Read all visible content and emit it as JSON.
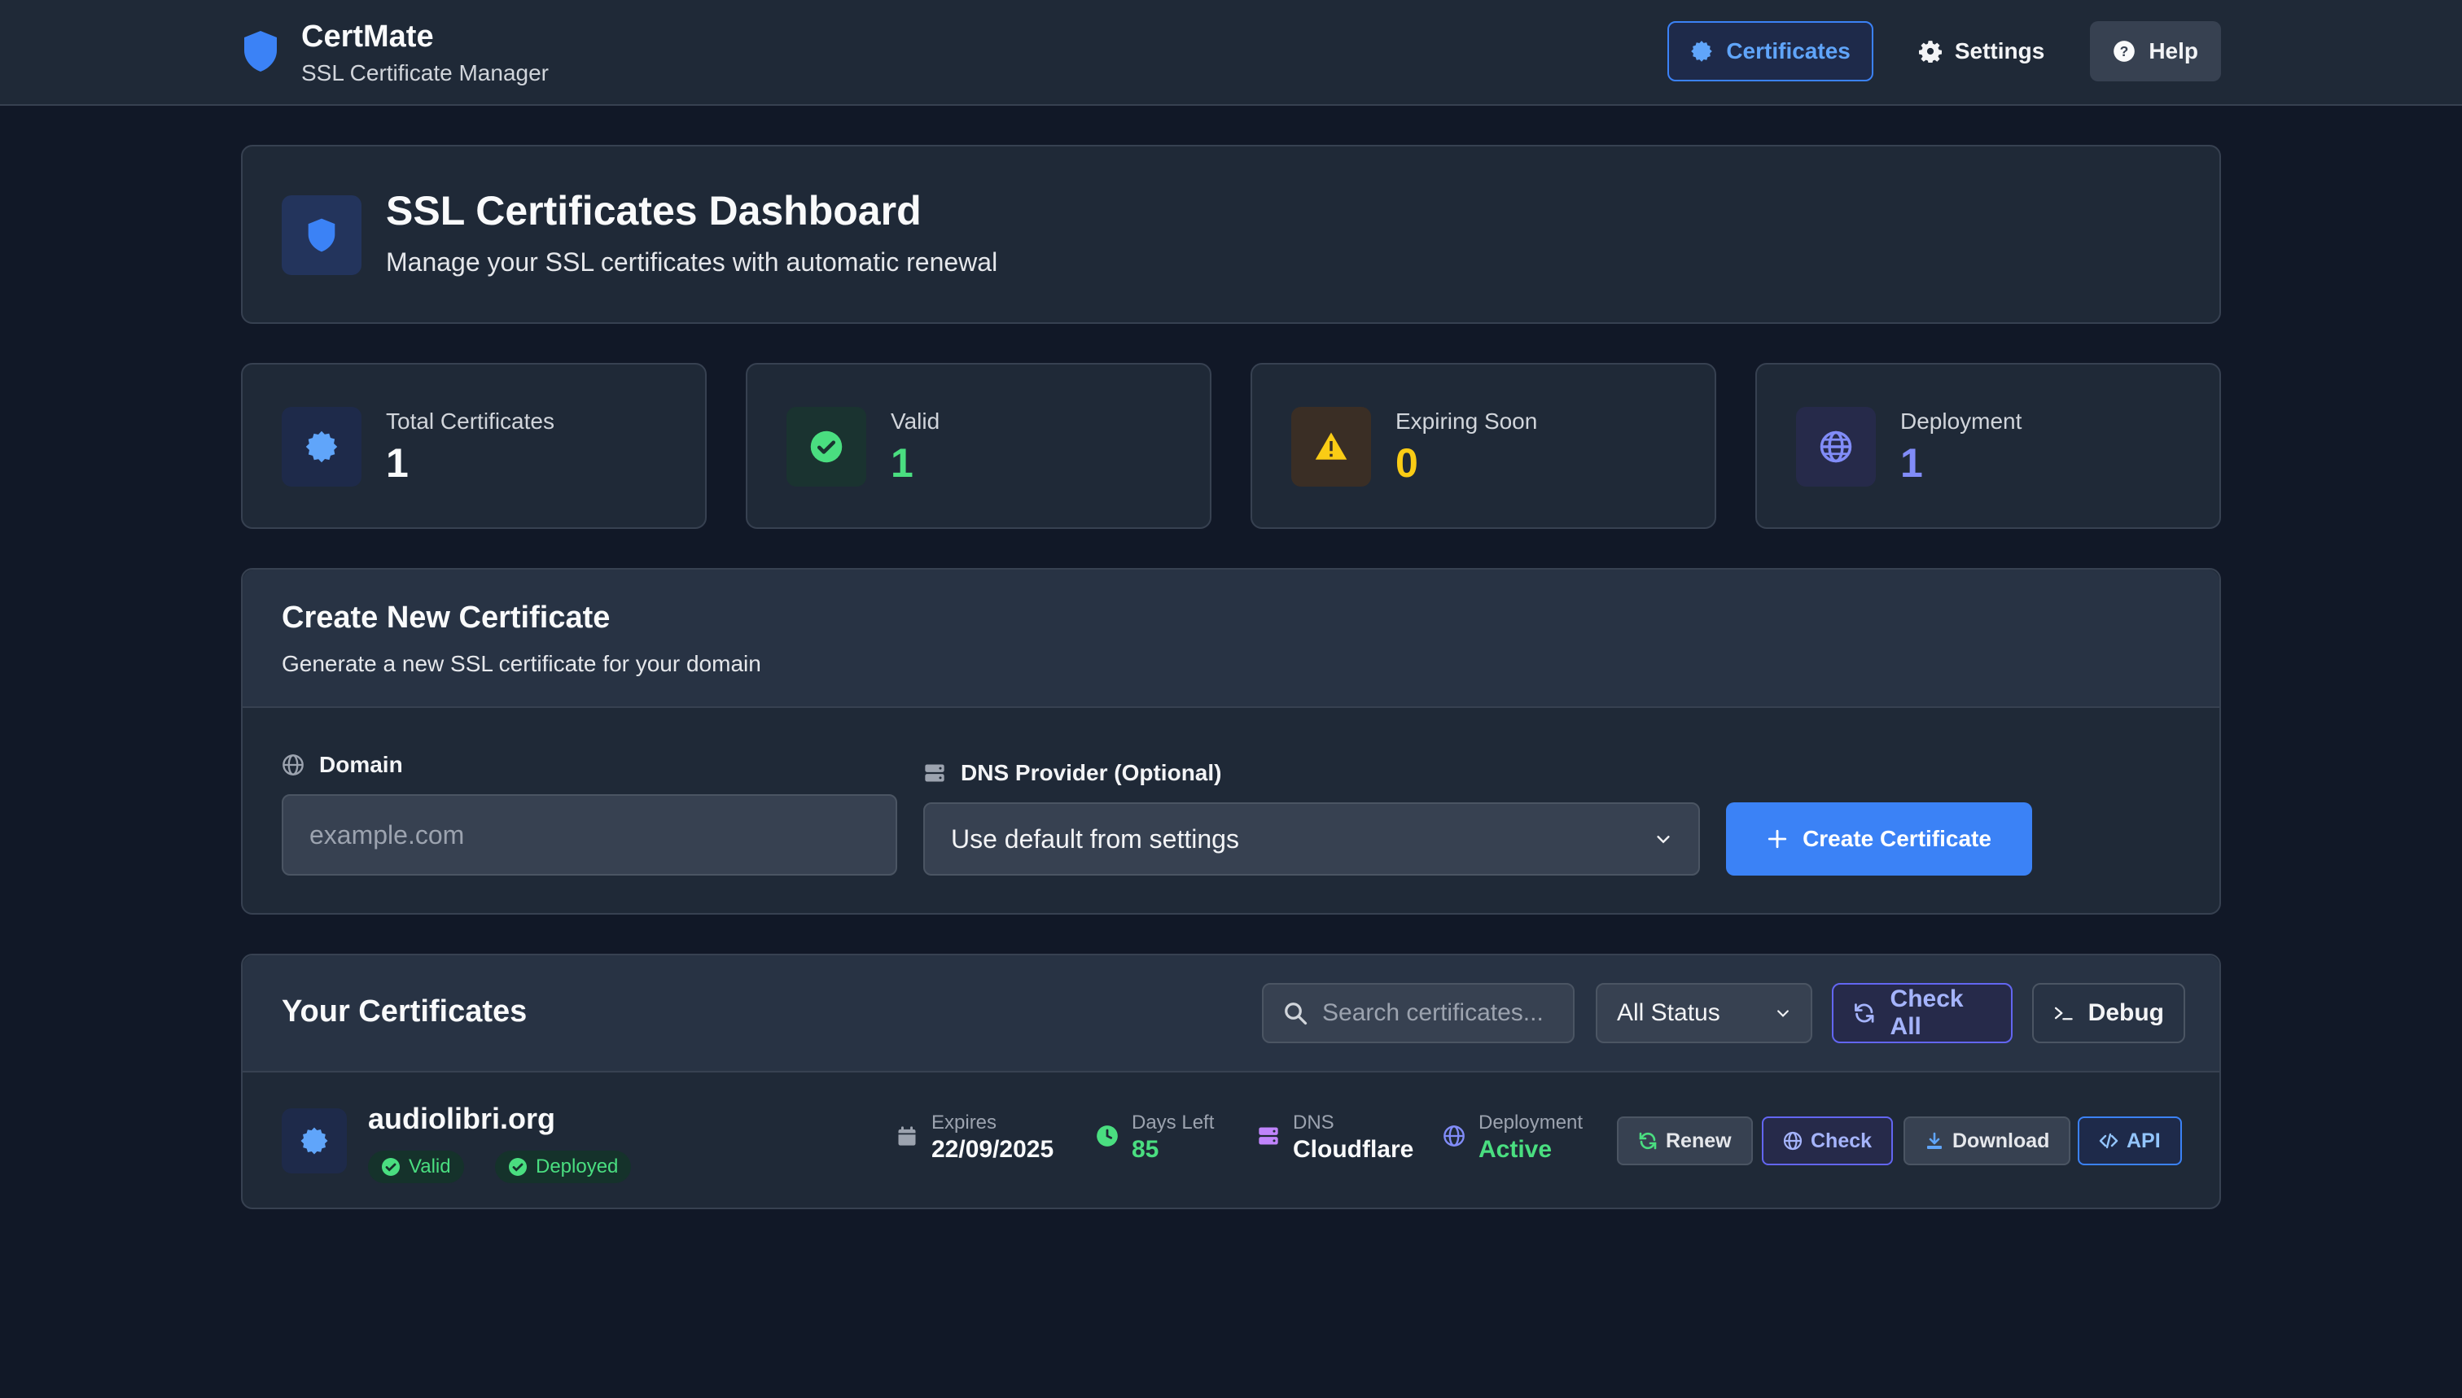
{
  "app": {
    "name": "CertMate",
    "subtitle": "SSL Certificate Manager"
  },
  "nav": {
    "certificates": "Certificates",
    "settings": "Settings",
    "help": "Help"
  },
  "hero": {
    "title": "SSL Certificates Dashboard",
    "subtitle": "Manage your SSL certificates with automatic renewal"
  },
  "stats": {
    "total": {
      "label": "Total Certificates",
      "value": "1"
    },
    "valid": {
      "label": "Valid",
      "value": "1"
    },
    "expiring": {
      "label": "Expiring Soon",
      "value": "0"
    },
    "deployment": {
      "label": "Deployment",
      "value": "1"
    }
  },
  "create": {
    "title": "Create New Certificate",
    "subtitle": "Generate a new SSL certificate for your domain",
    "domain_label": "Domain",
    "domain_placeholder": "example.com",
    "dns_label": "DNS Provider (Optional)",
    "dns_selected": "Use default from settings",
    "submit": "Create Certificate"
  },
  "certs": {
    "title": "Your Certificates",
    "search_placeholder": "Search certificates...",
    "filter_selected": "All Status",
    "check_all": "Check All",
    "debug": "Debug",
    "rows": [
      {
        "domain": "audiolibri.org",
        "status_badge": "Valid",
        "deploy_badge": "Deployed",
        "expires_label": "Expires",
        "expires": "22/09/2025",
        "days_label": "Days Left",
        "days": "85",
        "dns_label": "DNS",
        "dns": "Cloudflare",
        "deployment_label": "Deployment",
        "deployment": "Active",
        "actions": {
          "renew": "Renew",
          "check": "Check",
          "download": "Download",
          "api": "API"
        }
      }
    ]
  },
  "colors": {
    "accent": "#3b82f6",
    "success": "#4ade80",
    "warning": "#facc15",
    "purple": "#818cf8",
    "background": "#111827",
    "card": "#1f2937"
  }
}
